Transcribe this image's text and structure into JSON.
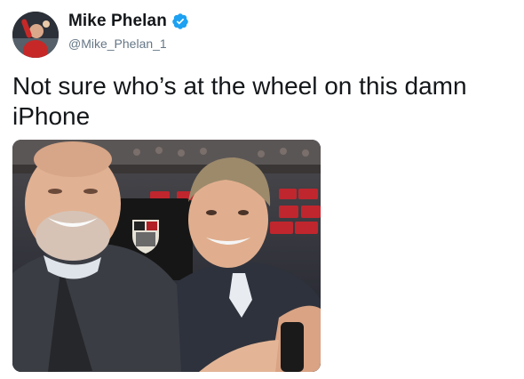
{
  "tweet": {
    "display_name": "Mike Phelan",
    "handle": "@Mike_Phelan_1",
    "text": "Not sure who’s at the wheel on this damn iPhone",
    "verified": true
  },
  "icons": {
    "verified": "verified-badge-icon",
    "avatar": "profile-avatar",
    "media": "selfie-photo"
  },
  "colors": {
    "text": "#14171a",
    "handle": "#657786",
    "verified_badge": "#1da1f2"
  }
}
